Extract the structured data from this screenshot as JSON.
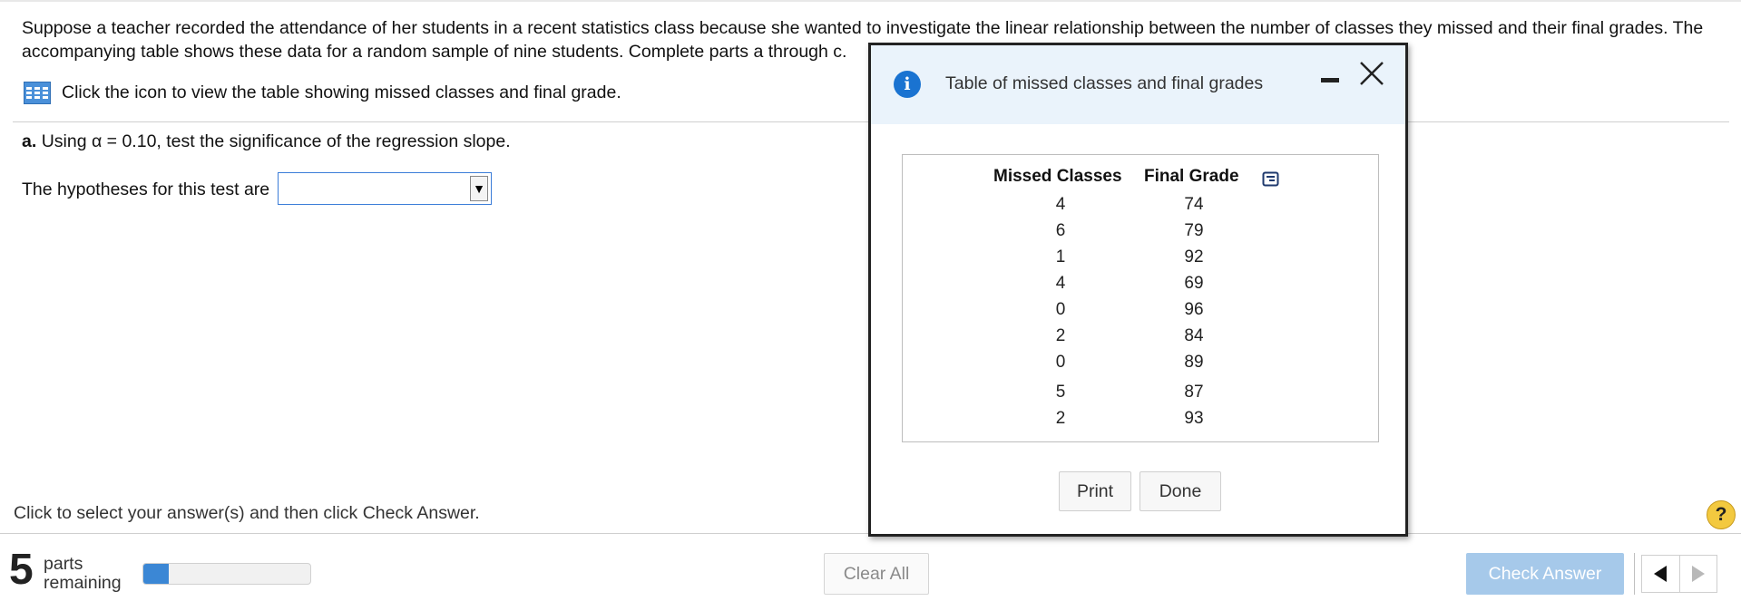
{
  "question": {
    "text": "Suppose a teacher recorded the attendance of her students in a recent statistics class because she wanted to investigate the linear relationship between the number of classes they missed and their final grades. The accompanying table shows these data for a random sample of nine students. Complete parts a through c.",
    "table_link_text": "Click the icon to view the table showing missed classes and final grade.",
    "table_icon": "table-grid-icon"
  },
  "part_a": {
    "label": "a.",
    "text": "Using α = 0.10, test the significance of the regression slope.",
    "hypotheses_label": "The hypotheses for this test are",
    "hypotheses_value": "",
    "dropdown_arrow": "▼"
  },
  "footer": {
    "instruction": "Click to select your answer(s) and then click Check Answer.",
    "parts_count": "5",
    "parts_line1": "parts",
    "parts_line2": "remaining",
    "progress_fraction": 0.15,
    "clear_label": "Clear All",
    "check_label": "Check Answer",
    "help_label": "?"
  },
  "dialog": {
    "title": "Table of missed classes and final grades",
    "info_label": "i",
    "col1_header": "Missed Classes",
    "col2_header": "Final Grade",
    "rows": [
      {
        "missed": "4",
        "grade": "74"
      },
      {
        "missed": "6",
        "grade": "79"
      },
      {
        "missed": "1",
        "grade": "92"
      },
      {
        "missed": "4",
        "grade": "69"
      },
      {
        "missed": "0",
        "grade": "96"
      },
      {
        "missed": "2",
        "grade": "84"
      },
      {
        "missed": "0",
        "grade": "89"
      },
      {
        "missed": "5",
        "grade": "87"
      },
      {
        "missed": "2",
        "grade": "93"
      }
    ],
    "print_label": "Print",
    "done_label": "Done"
  },
  "colors": {
    "accent": "#3b87d5",
    "check_button": "#a6c9ea",
    "dialog_header": "#eaf3fb",
    "help": "#f3c93f"
  }
}
